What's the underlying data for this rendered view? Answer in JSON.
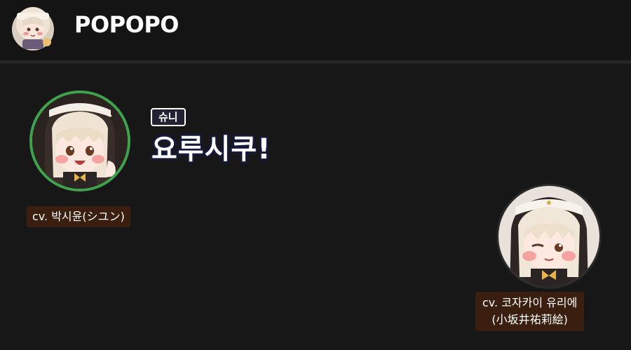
{
  "header": {
    "app_title": "POPOPO",
    "logo_icon": "chibi-character-logo"
  },
  "speech": {
    "speaker_name": "슈니",
    "text": "요루시쿠!"
  },
  "participants": [
    {
      "avatar_icon": "chibi-nun-avatar-open-mouth",
      "cv_label": "cv. 박시윤(シユン)",
      "speaking": true,
      "ring_color": "#3fa34d"
    },
    {
      "avatar_icon": "chibi-nun-avatar-calm",
      "cv_label_line1": "cv. 코자카이  유리에",
      "cv_label_line2": "(小坂井祐莉絵)",
      "speaking": false
    }
  ],
  "colors": {
    "background": "#171717",
    "header_background": "#141414",
    "cv_tag_background": "#3a1f10",
    "speaking_ring": "#3fa34d"
  }
}
